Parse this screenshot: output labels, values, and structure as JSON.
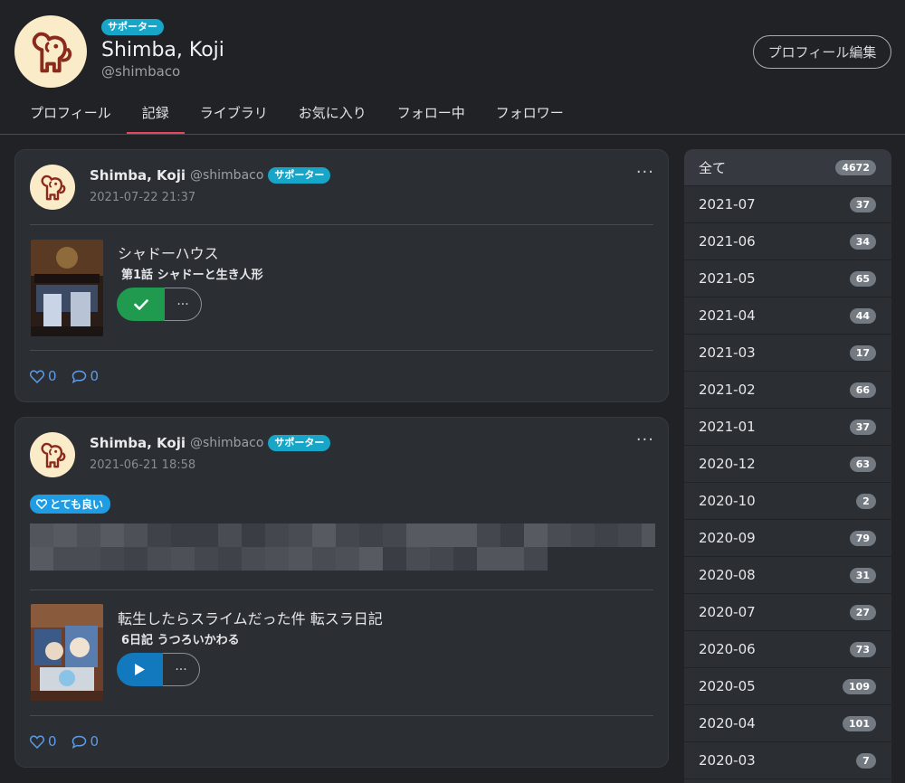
{
  "profile": {
    "supporter_label": "サポーター",
    "name": "Shimba, Koji",
    "handle": "@shimbaco",
    "edit_label": "プロフィール編集",
    "avatar_icon": "lion-icon"
  },
  "tabs": [
    {
      "label": "プロフィール",
      "active": false
    },
    {
      "label": "記録",
      "active": true
    },
    {
      "label": "ライブラリ",
      "active": false
    },
    {
      "label": "お気に入り",
      "active": false
    },
    {
      "label": "フォロー中",
      "active": false
    },
    {
      "label": "フォロワー",
      "active": false
    }
  ],
  "records": [
    {
      "user_name": "Shimba, Koji",
      "user_handle": "@shimbaco",
      "supporter_label": "サポーター",
      "timestamp": "2021-07-22 21:37",
      "more": "···",
      "work_title": "シャドーハウス",
      "episode": "第1話 シャドーと生き人形",
      "status": "watched",
      "options": "···",
      "likes": "0",
      "comments": "0"
    },
    {
      "user_name": "Shimba, Koji",
      "user_handle": "@shimbaco",
      "supporter_label": "サポーター",
      "timestamp": "2021-06-21 18:58",
      "more": "···",
      "rating": "とても良い",
      "work_title": "転生したらスライムだった件 転スラ日記",
      "episode": "6日記 うつろいかわる",
      "status": "play",
      "options": "···",
      "likes": "0",
      "comments": "0"
    }
  ],
  "months": [
    {
      "label": "全て",
      "count": "4672"
    },
    {
      "label": "2021-07",
      "count": "37"
    },
    {
      "label": "2021-06",
      "count": "34"
    },
    {
      "label": "2021-05",
      "count": "65"
    },
    {
      "label": "2021-04",
      "count": "44"
    },
    {
      "label": "2021-03",
      "count": "17"
    },
    {
      "label": "2021-02",
      "count": "66"
    },
    {
      "label": "2021-01",
      "count": "37"
    },
    {
      "label": "2020-12",
      "count": "63"
    },
    {
      "label": "2020-10",
      "count": "2"
    },
    {
      "label": "2020-09",
      "count": "79"
    },
    {
      "label": "2020-08",
      "count": "31"
    },
    {
      "label": "2020-07",
      "count": "27"
    },
    {
      "label": "2020-06",
      "count": "73"
    },
    {
      "label": "2020-05",
      "count": "109"
    },
    {
      "label": "2020-04",
      "count": "101"
    },
    {
      "label": "2020-03",
      "count": "7"
    }
  ],
  "colors": {
    "background": "#202226",
    "card": "#2b2e33",
    "accent_tab": "#e8455f",
    "supporter": "#17a5c8",
    "watched_green": "#1f9a4f",
    "play_blue": "#1379be",
    "reaction_blue": "#5e9be6"
  }
}
